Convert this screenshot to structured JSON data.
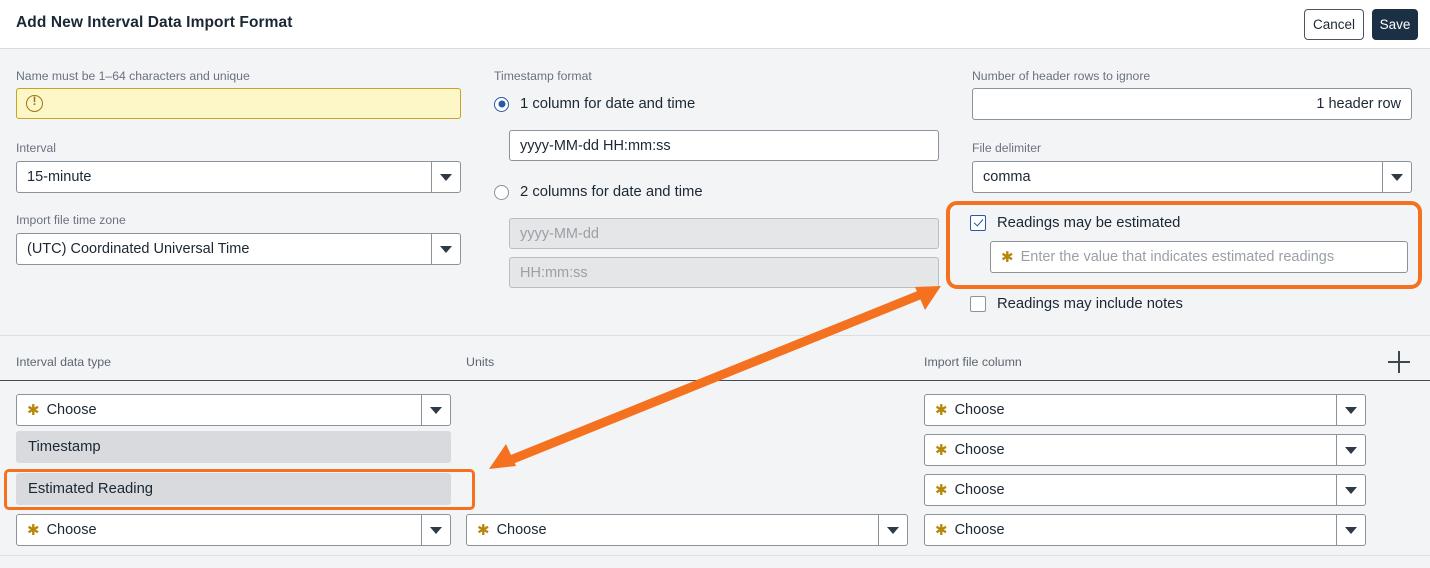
{
  "header": {
    "title": "Add New Interval Data Import Format",
    "cancel_label": "Cancel",
    "save_label": "Save"
  },
  "left_column": {
    "name_field": {
      "label": "Name must be 1–64 characters and unique",
      "value": "",
      "state": "warning",
      "icon": "warning-exclamation-circle-icon"
    },
    "interval": {
      "label": "Interval",
      "value": "15-minute",
      "icon": "chevron-down-icon"
    },
    "time_zone": {
      "label": "Import file time zone",
      "value": "(UTC) Coordinated Universal Time",
      "icon": "chevron-down-icon"
    }
  },
  "middle_column": {
    "timestamp_format_label": "Timestamp format",
    "option_one_column": {
      "label": "1 column for date and time",
      "selected": true,
      "input_value": "yyyy-MM-dd HH:mm:ss"
    },
    "option_two_columns": {
      "label": "2 columns for date and time",
      "selected": false,
      "date_placeholder": "yyyy-MM-dd",
      "time_placeholder": "HH:mm:ss"
    }
  },
  "right_column": {
    "header_rows": {
      "label": "Number of header rows to ignore",
      "value": "1 header row"
    },
    "file_delimiter": {
      "label": "File delimiter",
      "value": "comma",
      "icon": "chevron-down-icon"
    },
    "estimated": {
      "label": "Readings may be estimated",
      "checked": true,
      "input_placeholder": "Enter the value that indicates estimated readings",
      "required_marker": "✱"
    },
    "notes": {
      "label": "Readings may include notes",
      "checked": false
    }
  },
  "table": {
    "columns": [
      {
        "label": "Interval data type"
      },
      {
        "label": "Units"
      },
      {
        "label": "Import file column"
      }
    ],
    "add_row_icon": "plus-icon",
    "choose_placeholder": "Choose",
    "required_marker": "✱",
    "open_dropdown": {
      "field": "interval-data-type",
      "options": [
        "Timestamp",
        "Estimated Reading"
      ],
      "highlighted_option": "Estimated Reading"
    },
    "rows": [
      {
        "interval_data_type": "Choose",
        "units": "",
        "import_file_column": "Choose"
      },
      {
        "interval_data_type": "",
        "units": "",
        "import_file_column": "Choose"
      },
      {
        "interval_data_type": "",
        "units": "",
        "import_file_column": "Choose"
      },
      {
        "interval_data_type": "Choose",
        "units": "Choose",
        "import_file_column": "Choose"
      }
    ]
  },
  "annotations": {
    "highlight_color": "#f4711f",
    "arrow": "double-headed-arrow",
    "boxes": [
      "readings-may-be-estimated-group",
      "estimated-reading-dropdown-option"
    ]
  },
  "colors": {
    "accent_blue": "#2b57a8",
    "save_dark": "#1b3044",
    "warning_bg": "#fdf6c7",
    "warning_border": "#c8a227",
    "page_bg": "#f2f4f5",
    "orange": "#f4711f"
  }
}
